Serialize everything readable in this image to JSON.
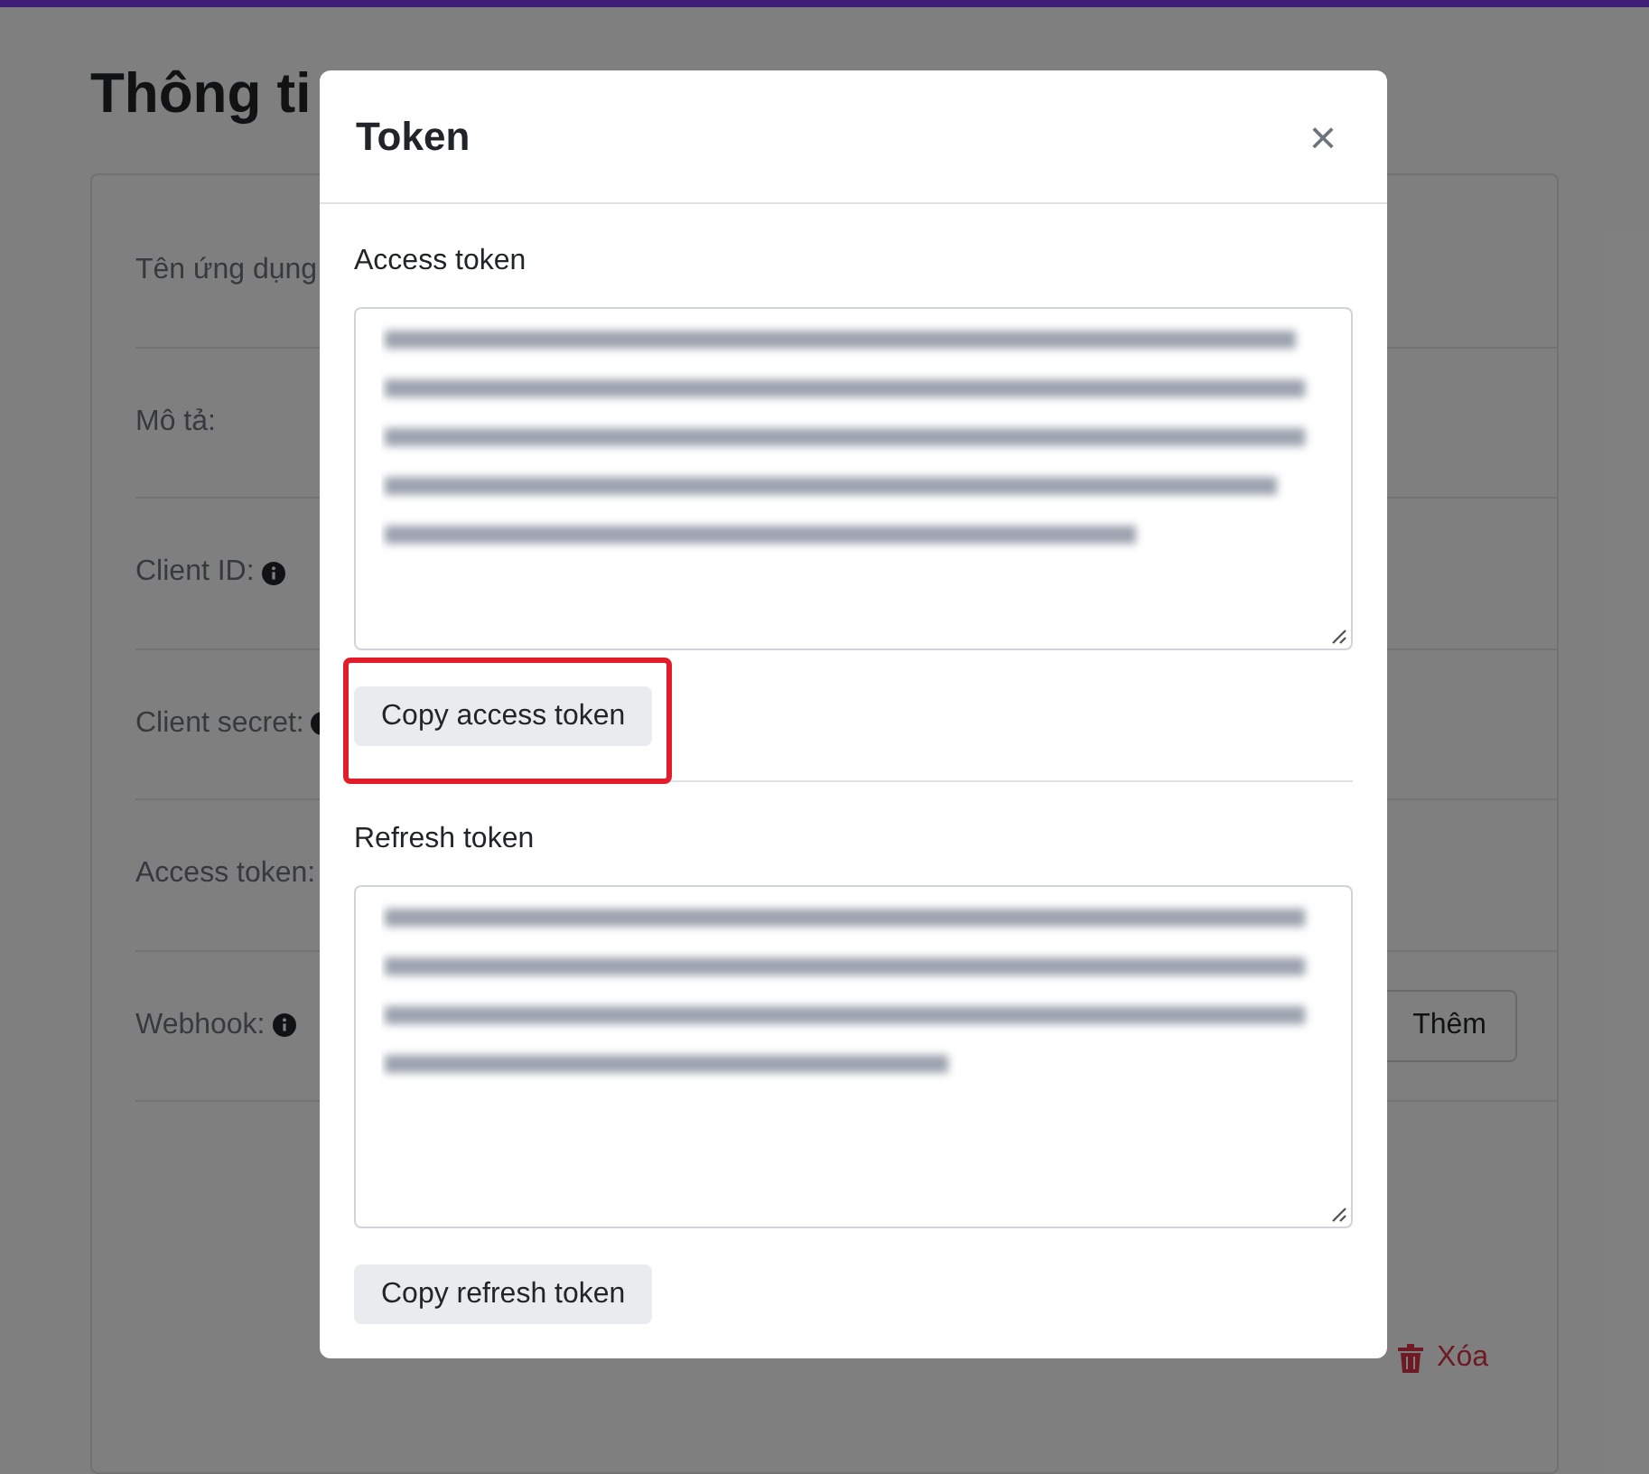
{
  "page": {
    "title": "Thông ti",
    "fields": [
      {
        "label": "Tên ứng dụng",
        "info": false,
        "kind": "text"
      },
      {
        "label": "Mô tả:",
        "info": false,
        "kind": "text"
      },
      {
        "label": "Client ID:",
        "info": true,
        "kind": "text"
      },
      {
        "label": "Client secret:",
        "info": true,
        "kind": "text"
      },
      {
        "label": "Access token:",
        "info": false,
        "kind": "text"
      },
      {
        "label": "Webhook:",
        "info": true,
        "kind": "webhook",
        "button": "Thêm"
      }
    ],
    "delete_button": "Xóa"
  },
  "modal": {
    "title": "Token",
    "close": "×",
    "sections": [
      {
        "label": "Access token",
        "button": "Copy access token",
        "highlighted": true
      },
      {
        "label": "Refresh token",
        "button": "Copy refresh token",
        "highlighted": false
      }
    ]
  }
}
